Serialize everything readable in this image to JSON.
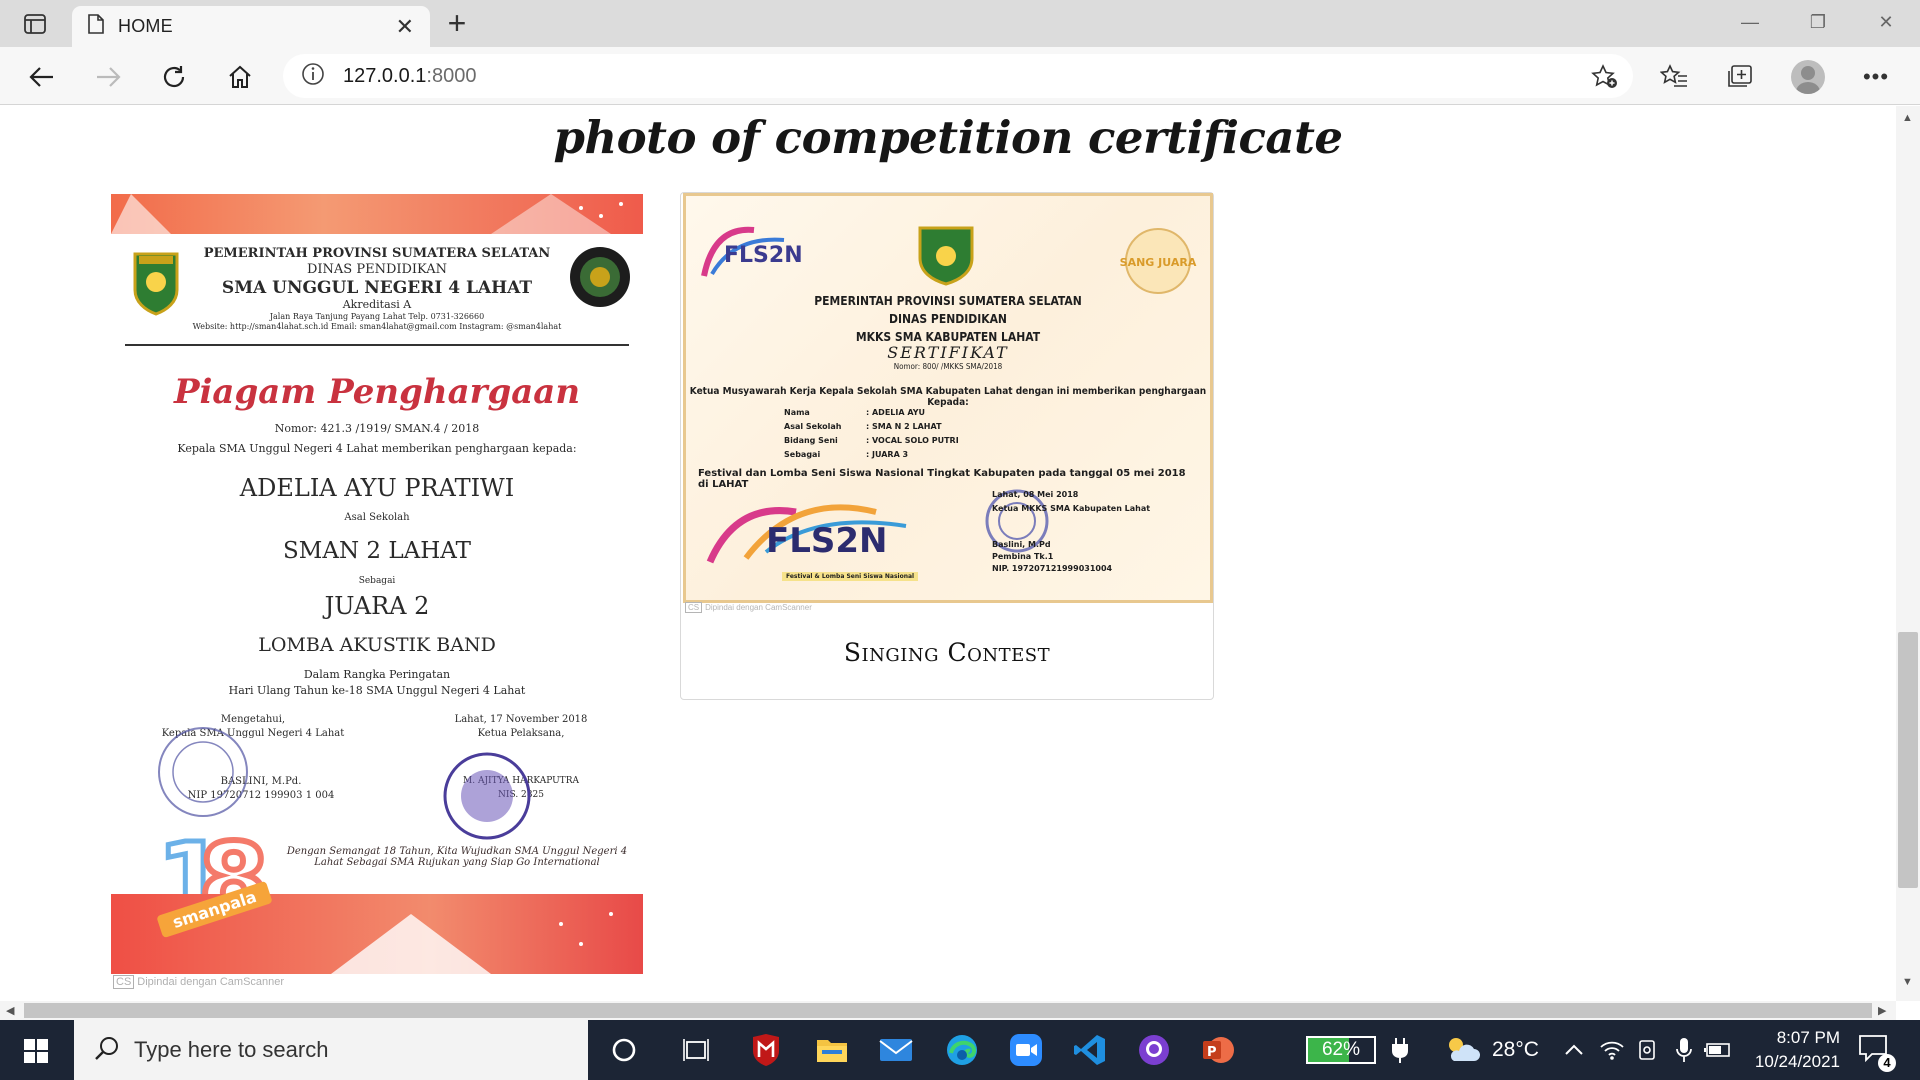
{
  "browser": {
    "tab_title": "HOME",
    "url_host": "127.0.0.1",
    "url_port": ":8000"
  },
  "page": {
    "heading": "photo of competition certificate",
    "cards": [
      {
        "caption": "",
        "certificate": {
          "gov_line1": "PEMERINTAH PROVINSI SUMATERA SELATAN",
          "gov_line2": "DINAS PENDIDIKAN",
          "school": "SMA UNGGUL NEGERI 4 LAHAT",
          "accreditation": "Akreditasi A",
          "address": "Jalan Raya Tanjung Payang Lahat Telp. 0731-326660",
          "web": "Website: http://sman4lahat.sch.id  Email: sman4lahat@gmail.com Instagram: @sman4lahat",
          "title": "Piagam Penghargaan",
          "number": "Nomor: 421.3 /1919/ SMAN.4 / 2018",
          "given_by": "Kepala SMA Unggul Negeri 4 Lahat memberikan penghargaan kepada:",
          "name": "ADELIA AYU PRATIWI",
          "school_label": "Asal Sekolah",
          "origin": "SMAN 2 LAHAT",
          "as_label": "Sebagai",
          "rank": "JUARA 2",
          "event": "LOMBA AKUSTIK BAND",
          "occasion1": "Dalam Rangka Peringatan",
          "occasion2": "Hari Ulang Tahun ke-18 SMA Unggul Negeri 4 Lahat",
          "acknowledged": "Mengetahui,",
          "head_title": "Kepala SMA Unggul Negeri 4 Lahat",
          "head_name": "BASLINI, M.Pd.",
          "head_nip": "NIP 19720712 199903 1 004",
          "date": "Lahat, 17 November 2018",
          "chair_title": "Ketua Pelaksana,",
          "chair_name": "M. AJITYA HARKAPUTRA",
          "chair_nip": "NIS. 2825",
          "motto": "Dengan Semangat 18 Tahun, Kita Wujudkan SMA Unggul Negeri 4 Lahat Sebagai SMA Rujukan yang Siap Go International",
          "badge": "smanpala",
          "scan_note": "Dipindai dengan CamScanner"
        }
      },
      {
        "caption": "Singing Contest",
        "certificate": {
          "logo_left": "FLS2N",
          "stamp_right": "SANG JUARA",
          "gov_line1": "PEMERINTAH PROVINSI SUMATERA SELATAN",
          "gov_line2": "DINAS PENDIDIKAN",
          "gov_line3": "MKKS SMA KABUPATEN LAHAT",
          "title": "SERTIFIKAT",
          "number": "Nomor: 800/   /MKKS SMA/2018",
          "intro": "Ketua Musyawarah Kerja Kepala Sekolah SMA Kabupaten Lahat dengan ini memberikan penghargaan Kepada:",
          "fields": [
            {
              "label": "Nama",
              "value": "ADELIA AYU"
            },
            {
              "label": "Asal Sekolah",
              "value": "SMA N 2 LAHAT"
            },
            {
              "label": "Bidang Seni",
              "value": "VOCAL SOLO PUTRI"
            },
            {
              "label": "Sebagai",
              "value": "JUARA 3"
            }
          ],
          "event": "Festival dan Lomba Seni Siswa Nasional Tingkat Kabupaten pada tanggal 05 mei 2018 di LAHAT",
          "date": "Lahat, 08 Mei 2018",
          "signer_title": "Ketua MKKS SMA Kabupaten Lahat",
          "signer_name": "Baslini, M.Pd",
          "signer_rank": "Pembina Tk.1",
          "signer_nip": "NIP. 197207121999031004",
          "logo_bottom": "FLS2N",
          "logo_bottom_sub": "Festival & Lomba Seni Siswa Nasional",
          "scan_note": "Dipindai dengan CamScanner"
        }
      }
    ]
  },
  "taskbar": {
    "search_placeholder": "Type here to search",
    "battery": "62%",
    "battery_level": 0.62,
    "temperature": "28°C",
    "time": "8:07 PM",
    "date": "10/24/2021",
    "notifications": "4"
  },
  "colors": {
    "chrome_bg": "#dcdcdc",
    "taskbar_bg": "#1c2535",
    "battery_green": "#3cb54a"
  }
}
